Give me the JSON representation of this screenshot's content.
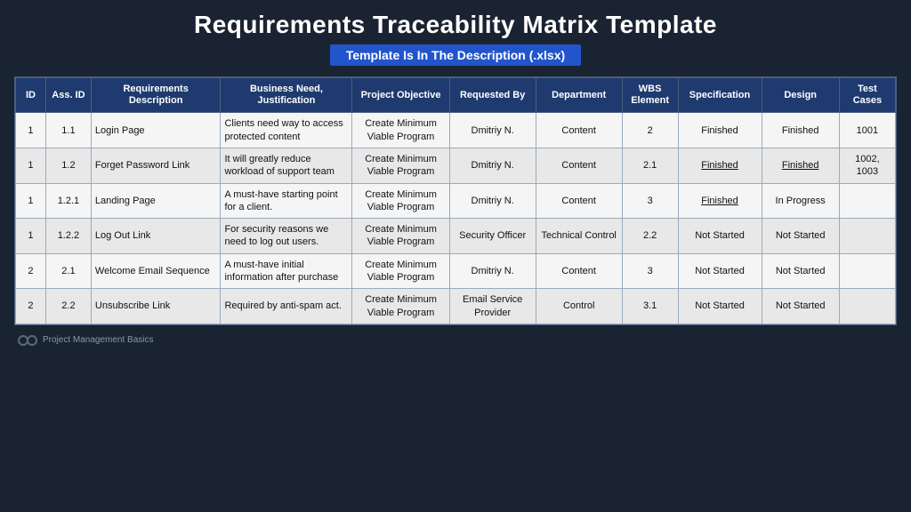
{
  "title": "Requirements Traceability Matrix Template",
  "subtitle": "Template Is In The Description (.xlsx)",
  "footer": "Project Management Basics",
  "columns": [
    {
      "key": "id",
      "label": "ID"
    },
    {
      "key": "assid",
      "label": "Ass. ID"
    },
    {
      "key": "req_desc",
      "label": "Requirements Description"
    },
    {
      "key": "business",
      "label": "Business Need, Justification"
    },
    {
      "key": "proj_obj",
      "label": "Project Objective"
    },
    {
      "key": "req_by",
      "label": "Requested By"
    },
    {
      "key": "dept",
      "label": "Department"
    },
    {
      "key": "wbs",
      "label": "WBS Element"
    },
    {
      "key": "spec",
      "label": "Specification"
    },
    {
      "key": "design",
      "label": "Design"
    },
    {
      "key": "test",
      "label": "Test Cases"
    }
  ],
  "rows": [
    {
      "id": "1",
      "assid": "1.1",
      "req_desc": "Login Page",
      "business": "Clients need way to access protected content",
      "proj_obj": "Create Minimum Viable Program",
      "req_by": "Dmitriy N.",
      "dept": "Content",
      "wbs": "2",
      "spec": "Finished",
      "spec_underline": false,
      "design": "Finished",
      "design_underline": false,
      "test": "1001"
    },
    {
      "id": "1",
      "assid": "1.2",
      "req_desc": "Forget Password Link",
      "business": "It will greatly reduce workload of support team",
      "proj_obj": "Create Minimum Viable Program",
      "req_by": "Dmitriy N.",
      "dept": "Content",
      "wbs": "2.1",
      "spec": "Finished",
      "spec_underline": true,
      "design": "Finished",
      "design_underline": true,
      "test": "1002, 1003"
    },
    {
      "id": "1",
      "assid": "1.2.1",
      "req_desc": "Landing Page",
      "business": "A must-have starting point for a client.",
      "proj_obj": "Create Minimum Viable Program",
      "req_by": "Dmitriy N.",
      "dept": "Content",
      "wbs": "3",
      "spec": "Finished",
      "spec_underline": true,
      "design": "In Progress",
      "design_underline": false,
      "test": ""
    },
    {
      "id": "1",
      "assid": "1.2.2",
      "req_desc": "Log Out Link",
      "business": "For security reasons we need to log out users.",
      "proj_obj": "Create Minimum Viable Program",
      "req_by": "Security Officer",
      "dept": "Technical Control",
      "wbs": "2.2",
      "spec": "Not Started",
      "spec_underline": false,
      "design": "Not Started",
      "design_underline": false,
      "test": ""
    },
    {
      "id": "2",
      "assid": "2.1",
      "req_desc": "Welcome Email Sequence",
      "business": "A must-have initial information after purchase",
      "proj_obj": "Create Minimum Viable Program",
      "req_by": "Dmitriy N.",
      "dept": "Content",
      "wbs": "3",
      "spec": "Not Started",
      "spec_underline": false,
      "design": "Not Started",
      "design_underline": false,
      "test": ""
    },
    {
      "id": "2",
      "assid": "2.2",
      "req_desc": "Unsubscribe Link",
      "business": "Required by anti-spam act.",
      "proj_obj": "Create Minimum Viable Program",
      "req_by": "Email Service Provider",
      "dept": "Control",
      "wbs": "3.1",
      "spec": "Not Started",
      "spec_underline": false,
      "design": "Not Started",
      "design_underline": false,
      "test": ""
    }
  ]
}
